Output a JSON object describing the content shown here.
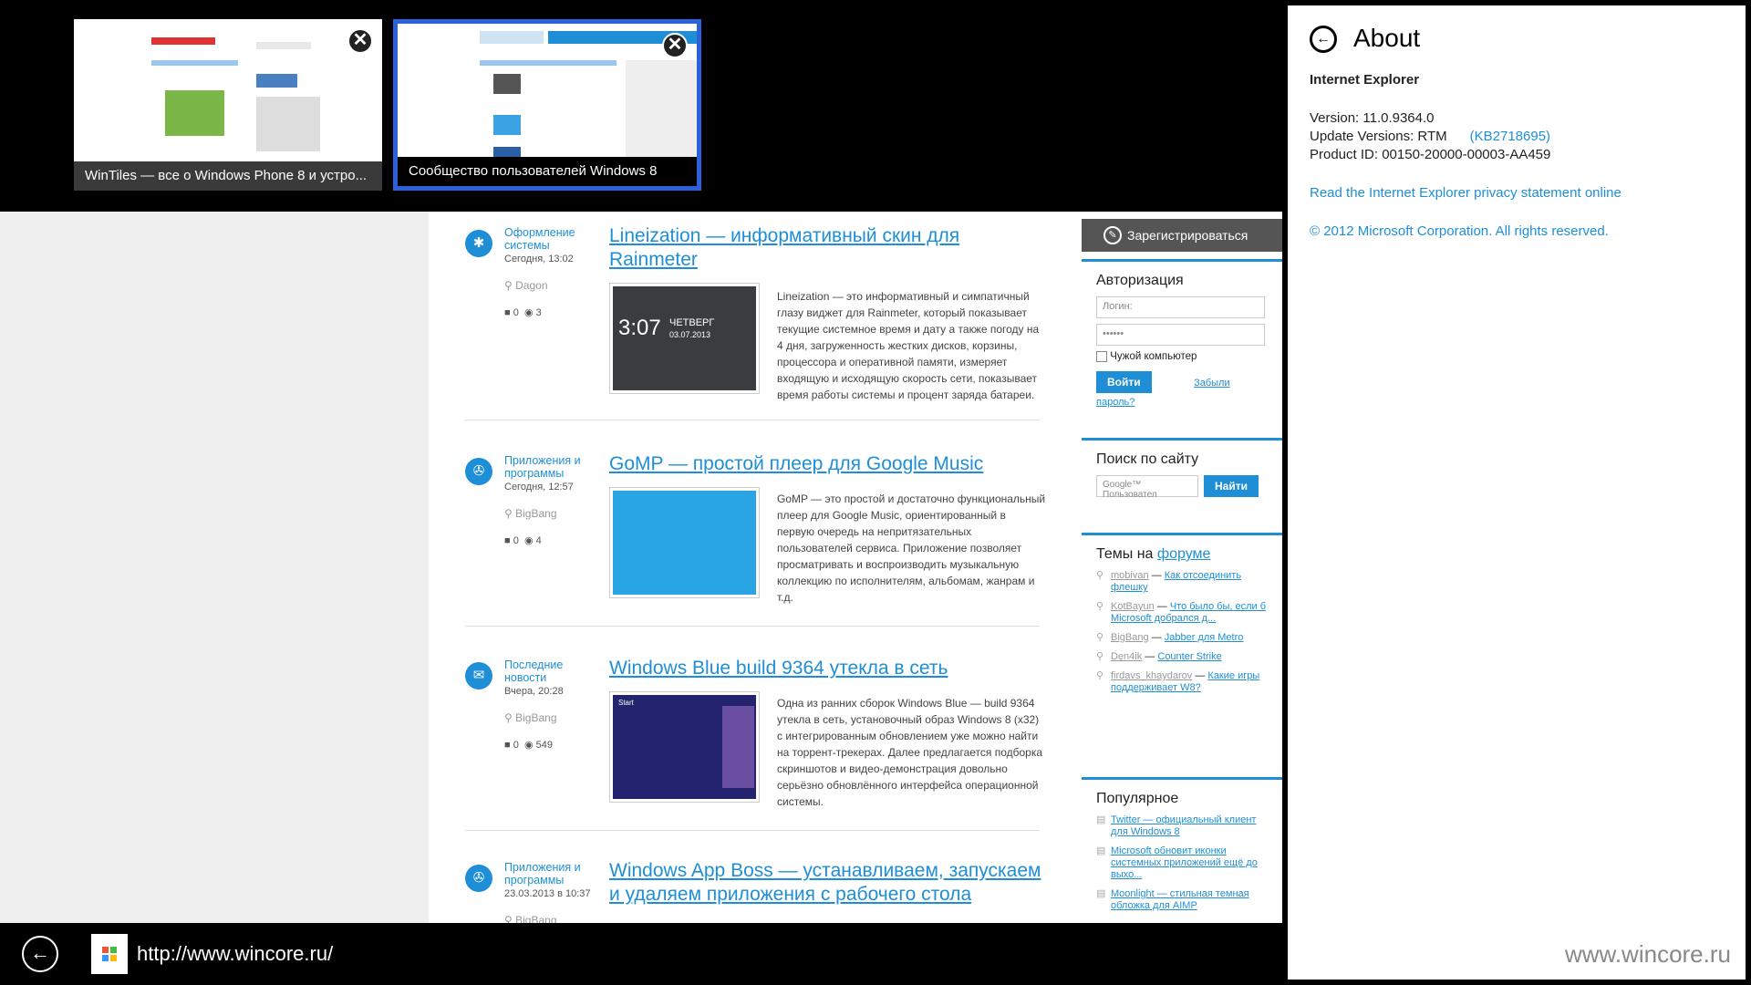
{
  "tabs": [
    {
      "caption": "WinTiles — все о Windows Phone 8 и устро...",
      "close": "✕"
    },
    {
      "caption": "Сообщество пользователей Windows 8",
      "close": "✕"
    }
  ],
  "articles": [
    {
      "category": "Оформление системы",
      "date": "Сегодня, 13:02",
      "author": "Dagon",
      "comments": "0",
      "views": "3",
      "title": "Lineization — информативный скин для Rainmeter",
      "text": "Lineization — это информативный и симпатичный глазу виджет для Rainmeter, который показывает текущие системное время и дату а также погоду на 4 дня, загруженность жестких дисков, корзины, процессора и оперативной памяти, измеряет входящую и исходящую скорость сети, показывает время работы системы и процент заряда батареи.",
      "img_time": "3:07",
      "img_day": "ЧЕТВЕРГ",
      "img_date": "03.07.2013"
    },
    {
      "category": "Приложения и программы",
      "date": "Сегодня, 12:57",
      "author": "BigBang",
      "comments": "0",
      "views": "4",
      "title": "GoMP — простой плеер для Google Music",
      "text": "GoMP — это простой и достаточно функциональный плеер для Google Music, ориентированный в первую очередь на непритязательных пользователей сервиса. Приложение позволяет просматривать и воспроизводить музыкальную коллекцию по исполнителям, альбомам, жанрам и т.д."
    },
    {
      "category": "Последние новости",
      "date": "Вчера, 20:28",
      "author": "BigBang",
      "comments": "0",
      "views": "549",
      "title": "Windows Blue build 9364 утекла в сеть",
      "text": "Одна из ранних сборок Windows Blue — build 9364 утекла в сеть, установочный образ Windows 8 (x32) с интегрированным обновлением уже можно найти на торрент-трекерах. Далее предлагается подборка скриншотов и видео-демонстрация довольно серьёзно обновлённого интерфейса операционной системы.",
      "img_start": "Start"
    },
    {
      "category": "Приложения и программы",
      "date": "23.03.2013 в 10:37",
      "author": "BigBang",
      "title": "Windows App Boss — устанавливаем, запускаем и удаляем приложения с рабочего стола"
    }
  ],
  "sidebar": {
    "register": "Зарегистрироваться",
    "auth_title": "Авторизация",
    "login_placeholder": "Логин:",
    "password_value": "••••••",
    "foreign_pc": "Чужой компьютер",
    "login_btn": "Войти",
    "forgot": "Забыли пароль?",
    "search_title": "Поиск по сайту",
    "search_placeholder": "Google™ Пользовател",
    "search_btn": "Найти",
    "forum_title_pre": "Темы на",
    "forum_title_link": "форуме",
    "forum": [
      {
        "user": "mobivan",
        "topic": "Как отсоединить флешку"
      },
      {
        "user": "KotBayun",
        "topic": "Что было бы, если б Microsoft добрался д..."
      },
      {
        "user": "BigBang",
        "topic": "Jabber для Metro"
      },
      {
        "user": "Den4ik",
        "topic": "Counter Strike"
      },
      {
        "user": "firdavs_khaydarov",
        "topic": "Какие игры поддерживает W8?"
      }
    ],
    "popular_title": "Популярное",
    "popular": [
      "Twitter — официальный клиент для Windows 8",
      "Microsoft обновит иконки системных приложений ещё до выхо...",
      "Moonlight — стильная темная обложка для AIMP"
    ]
  },
  "address": {
    "url": "http://www.wincore.ru/"
  },
  "about": {
    "title": "About",
    "product": "Internet Explorer",
    "version": "Version: 11.0.9364.0",
    "update_label": "Update Versions: RTM",
    "update_kb": "(KB2718695)",
    "product_id": "Product ID: 00150-20000-00003-AA459",
    "privacy": "Read the Internet Explorer privacy statement online",
    "copyright": "© 2012 Microsoft Corporation. All rights reserved.",
    "watermark": "www.wincore.ru"
  },
  "colors": {
    "accent": "#1e8fd6",
    "tab_selected_border": "#2a62d9"
  }
}
